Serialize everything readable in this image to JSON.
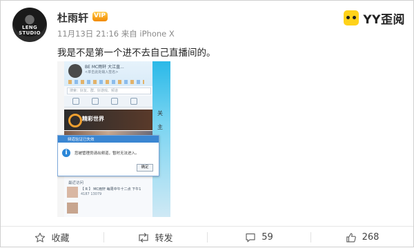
{
  "post": {
    "username": "杜雨轩",
    "vip_badge": "VIP",
    "avatar_caption": "LENG STUDIO",
    "date": "11月13日",
    "time": "21:16",
    "source_prefix": "来自",
    "source_device": "iPhone X",
    "content": "我是不是第一个进不去自己直播间的。"
  },
  "watermark": {
    "brand": "YY歪阅"
  },
  "embedded_screenshot": {
    "client_title": "BE MC雨轩 大江直...",
    "client_subtitle": "<单击此处输入签名>",
    "search_placeholder": "搜索：好友、群、好游戏、频道",
    "banner_text": "精彩世界",
    "dialog_title": "频道验证已失效",
    "dialog_message": "您被管理员请出频道，暂时无法进入。",
    "dialog_button": "确定",
    "recent_label": "最近访问",
    "row1_title": "【 R 】 MC雨轩  每周中午十二点  下午1",
    "row1_meta": "4187   13079",
    "side_chars": [
      "关",
      "主"
    ]
  },
  "footer": {
    "favorite_label": "收藏",
    "repost_label": "转发",
    "comment_count": "59",
    "like_count": "268"
  },
  "colors": {
    "text_main": "#222222",
    "text_meta": "#8a8a8a",
    "vip_orange": "#f28a00",
    "dialog_blue": "#3a86d2"
  }
}
